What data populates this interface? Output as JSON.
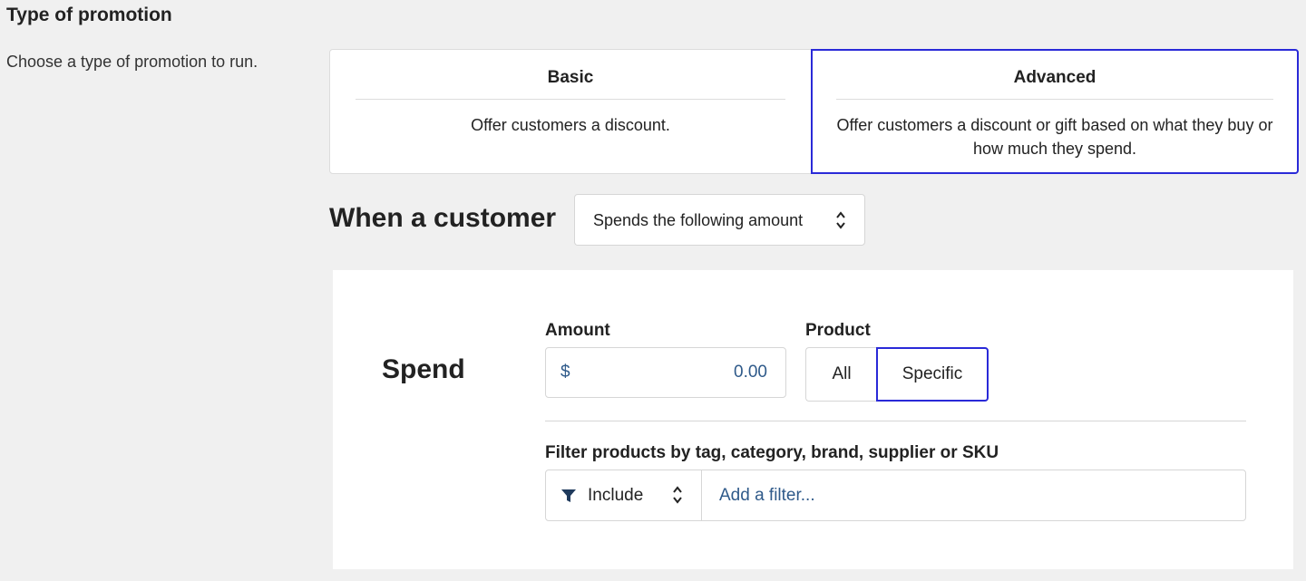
{
  "promotion_type": {
    "title": "Type of promotion",
    "description": "Choose a type of promotion to run.",
    "options": [
      {
        "title": "Basic",
        "description": "Offer customers a discount.",
        "selected": false
      },
      {
        "title": "Advanced",
        "description": "Offer customers a discount or gift based on what they buy or how much they spend.",
        "selected": true
      }
    ]
  },
  "condition": {
    "label": "When a customer",
    "selected": "Spends the following amount"
  },
  "spend": {
    "label": "Spend",
    "amount": {
      "label": "Amount",
      "currency": "$",
      "value": "0.00"
    },
    "product": {
      "label": "Product",
      "options": [
        "All",
        "Specific"
      ],
      "selected": "Specific"
    },
    "filter": {
      "label": "Filter products by tag, category, brand, supplier or SKU",
      "mode": "Include",
      "placeholder": "Add a filter..."
    }
  },
  "colors": {
    "accent": "#2a2ad8",
    "link_text": "#2f5a8a",
    "background": "#f0f0f0"
  }
}
